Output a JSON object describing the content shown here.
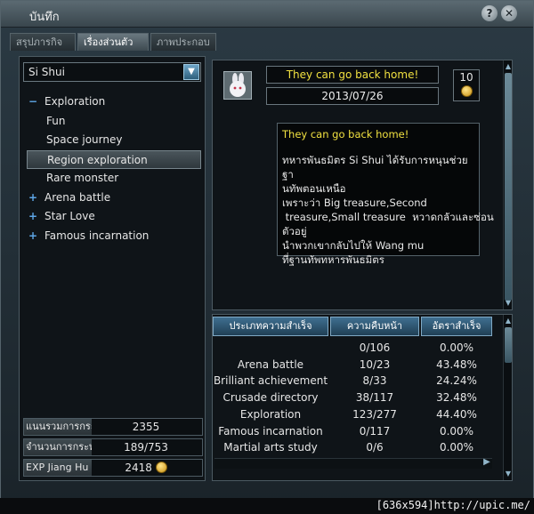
{
  "window": {
    "title": "บันทึก",
    "help_label": "?",
    "close_label": "✕"
  },
  "tabs": [
    {
      "label": "สรุปภารกิจ"
    },
    {
      "label": "เรื่องส่วนตัว"
    },
    {
      "label": "ภาพประกอบ"
    }
  ],
  "left": {
    "dropdown_value": "Si Shui",
    "tree": [
      {
        "sign": "−",
        "label": "Exploration"
      },
      {
        "label": "Fun"
      },
      {
        "label": "Space journey"
      },
      {
        "label": "Region exploration"
      },
      {
        "label": "Rare monster"
      },
      {
        "sign": "+",
        "label": "Arena battle"
      },
      {
        "sign": "+",
        "label": "Star Love"
      },
      {
        "sign": "+",
        "label": "Famous incarnation"
      }
    ],
    "stats": [
      {
        "key": "แนนรวมการกระ",
        "value": "2355"
      },
      {
        "key": "จำนวนการกระทำ",
        "value": "189/753"
      },
      {
        "key": "EXP Jiang Hu",
        "value": "2418"
      }
    ]
  },
  "detail": {
    "title": "They can go back home!",
    "date": "2013/07/26",
    "reward_count": "10",
    "message_title": "They can go back home!",
    "message_lines": [
      "ทหารพันธมิตร Si Shui ได้รับการหนุนช่วยฐา",
      "นทัพตอนเหนือ",
      "เพราะว่า Big  treasure,Second",
      " treasure,Small treasure  หวาดกลัวและซ่อน",
      "ตัวอยู่",
      "นำพวกเขากลับไปให้ Wang mu",
      "ที่ฐานทัพทหารพันธมิตร"
    ]
  },
  "table": {
    "headers": [
      "ประเภทความสำเร็จ",
      "ความคืบหน้า",
      "อัตราสำเร็จ"
    ],
    "rows": [
      {
        "type": "",
        "progress": "0/106",
        "rate": "0.00%"
      },
      {
        "type": "Arena battle",
        "progress": "10/23",
        "rate": "43.48%"
      },
      {
        "type": "Brilliant achievement",
        "progress": "8/33",
        "rate": "24.24%"
      },
      {
        "type": "Crusade directory",
        "progress": "38/117",
        "rate": "32.48%"
      },
      {
        "type": "Exploration",
        "progress": "123/277",
        "rate": "44.40%"
      },
      {
        "type": "Famous incarnation",
        "progress": "0/117",
        "rate": "0.00%"
      },
      {
        "type": "Martial arts study",
        "progress": "0/6",
        "rate": "0.00%"
      }
    ]
  },
  "footer": {
    "text": "[636x594]http://upic.me/"
  }
}
